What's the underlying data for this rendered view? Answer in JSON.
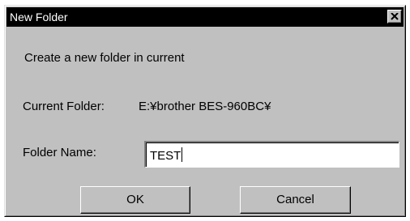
{
  "window": {
    "title": "New Folder",
    "close_symbol": "×"
  },
  "prompt": "Create a new folder in current",
  "current_folder": {
    "label": "Current Folder:",
    "value": "E:¥brother BES-960BC¥"
  },
  "folder_name": {
    "label": "Folder Name:",
    "value": "TEST"
  },
  "buttons": {
    "ok": "OK",
    "cancel": "Cancel"
  },
  "icons": {
    "close": "close-icon"
  },
  "colors": {
    "titlebar": "#000000",
    "title_text": "#ffffff",
    "dialog_face": "#c0c0c0",
    "textbox_bg": "#ffffff"
  }
}
